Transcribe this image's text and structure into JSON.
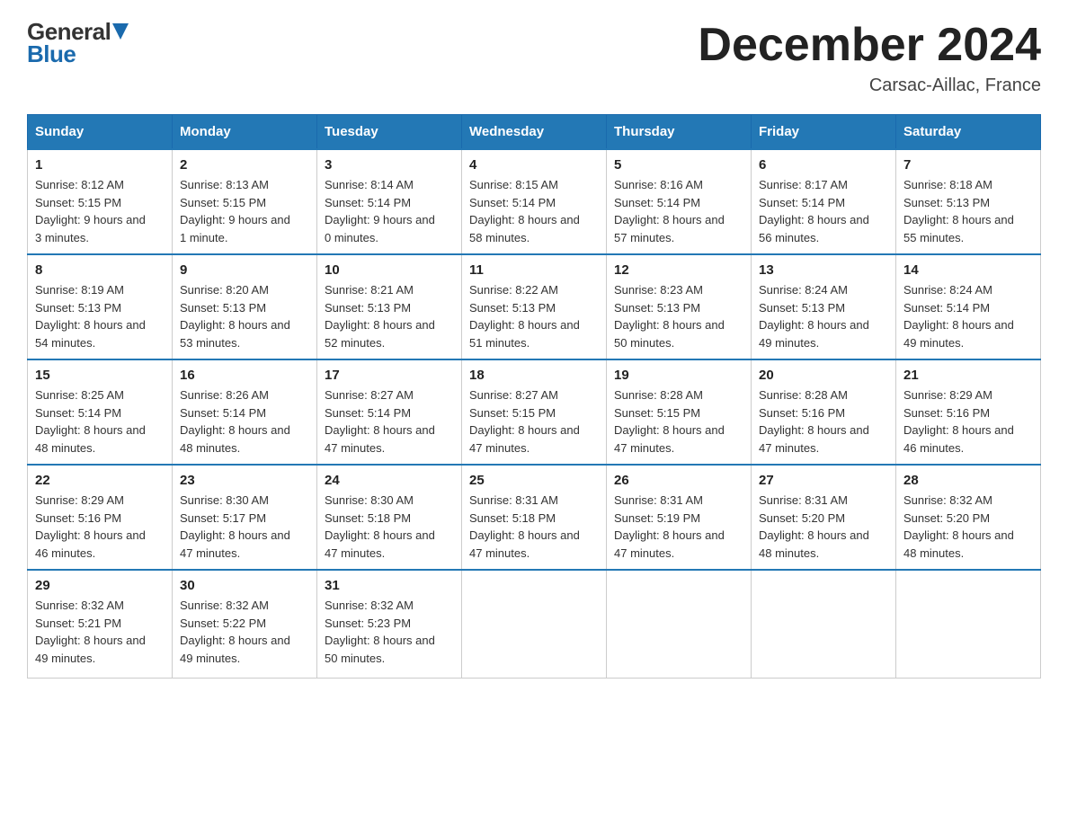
{
  "logo": {
    "general": "General",
    "blue": "Blue"
  },
  "header": {
    "month": "December 2024",
    "location": "Carsac-Aillac, France"
  },
  "days_of_week": [
    "Sunday",
    "Monday",
    "Tuesday",
    "Wednesday",
    "Thursday",
    "Friday",
    "Saturday"
  ],
  "weeks": [
    [
      {
        "day": "1",
        "sunrise": "8:12 AM",
        "sunset": "5:15 PM",
        "daylight": "9 hours and 3 minutes."
      },
      {
        "day": "2",
        "sunrise": "8:13 AM",
        "sunset": "5:15 PM",
        "daylight": "9 hours and 1 minute."
      },
      {
        "day": "3",
        "sunrise": "8:14 AM",
        "sunset": "5:14 PM",
        "daylight": "9 hours and 0 minutes."
      },
      {
        "day": "4",
        "sunrise": "8:15 AM",
        "sunset": "5:14 PM",
        "daylight": "8 hours and 58 minutes."
      },
      {
        "day": "5",
        "sunrise": "8:16 AM",
        "sunset": "5:14 PM",
        "daylight": "8 hours and 57 minutes."
      },
      {
        "day": "6",
        "sunrise": "8:17 AM",
        "sunset": "5:14 PM",
        "daylight": "8 hours and 56 minutes."
      },
      {
        "day": "7",
        "sunrise": "8:18 AM",
        "sunset": "5:13 PM",
        "daylight": "8 hours and 55 minutes."
      }
    ],
    [
      {
        "day": "8",
        "sunrise": "8:19 AM",
        "sunset": "5:13 PM",
        "daylight": "8 hours and 54 minutes."
      },
      {
        "day": "9",
        "sunrise": "8:20 AM",
        "sunset": "5:13 PM",
        "daylight": "8 hours and 53 minutes."
      },
      {
        "day": "10",
        "sunrise": "8:21 AM",
        "sunset": "5:13 PM",
        "daylight": "8 hours and 52 minutes."
      },
      {
        "day": "11",
        "sunrise": "8:22 AM",
        "sunset": "5:13 PM",
        "daylight": "8 hours and 51 minutes."
      },
      {
        "day": "12",
        "sunrise": "8:23 AM",
        "sunset": "5:13 PM",
        "daylight": "8 hours and 50 minutes."
      },
      {
        "day": "13",
        "sunrise": "8:24 AM",
        "sunset": "5:13 PM",
        "daylight": "8 hours and 49 minutes."
      },
      {
        "day": "14",
        "sunrise": "8:24 AM",
        "sunset": "5:14 PM",
        "daylight": "8 hours and 49 minutes."
      }
    ],
    [
      {
        "day": "15",
        "sunrise": "8:25 AM",
        "sunset": "5:14 PM",
        "daylight": "8 hours and 48 minutes."
      },
      {
        "day": "16",
        "sunrise": "8:26 AM",
        "sunset": "5:14 PM",
        "daylight": "8 hours and 48 minutes."
      },
      {
        "day": "17",
        "sunrise": "8:27 AM",
        "sunset": "5:14 PM",
        "daylight": "8 hours and 47 minutes."
      },
      {
        "day": "18",
        "sunrise": "8:27 AM",
        "sunset": "5:15 PM",
        "daylight": "8 hours and 47 minutes."
      },
      {
        "day": "19",
        "sunrise": "8:28 AM",
        "sunset": "5:15 PM",
        "daylight": "8 hours and 47 minutes."
      },
      {
        "day": "20",
        "sunrise": "8:28 AM",
        "sunset": "5:16 PM",
        "daylight": "8 hours and 47 minutes."
      },
      {
        "day": "21",
        "sunrise": "8:29 AM",
        "sunset": "5:16 PM",
        "daylight": "8 hours and 46 minutes."
      }
    ],
    [
      {
        "day": "22",
        "sunrise": "8:29 AM",
        "sunset": "5:16 PM",
        "daylight": "8 hours and 46 minutes."
      },
      {
        "day": "23",
        "sunrise": "8:30 AM",
        "sunset": "5:17 PM",
        "daylight": "8 hours and 47 minutes."
      },
      {
        "day": "24",
        "sunrise": "8:30 AM",
        "sunset": "5:18 PM",
        "daylight": "8 hours and 47 minutes."
      },
      {
        "day": "25",
        "sunrise": "8:31 AM",
        "sunset": "5:18 PM",
        "daylight": "8 hours and 47 minutes."
      },
      {
        "day": "26",
        "sunrise": "8:31 AM",
        "sunset": "5:19 PM",
        "daylight": "8 hours and 47 minutes."
      },
      {
        "day": "27",
        "sunrise": "8:31 AM",
        "sunset": "5:20 PM",
        "daylight": "8 hours and 48 minutes."
      },
      {
        "day": "28",
        "sunrise": "8:32 AM",
        "sunset": "5:20 PM",
        "daylight": "8 hours and 48 minutes."
      }
    ],
    [
      {
        "day": "29",
        "sunrise": "8:32 AM",
        "sunset": "5:21 PM",
        "daylight": "8 hours and 49 minutes."
      },
      {
        "day": "30",
        "sunrise": "8:32 AM",
        "sunset": "5:22 PM",
        "daylight": "8 hours and 49 minutes."
      },
      {
        "day": "31",
        "sunrise": "8:32 AM",
        "sunset": "5:23 PM",
        "daylight": "8 hours and 50 minutes."
      },
      null,
      null,
      null,
      null
    ]
  ]
}
